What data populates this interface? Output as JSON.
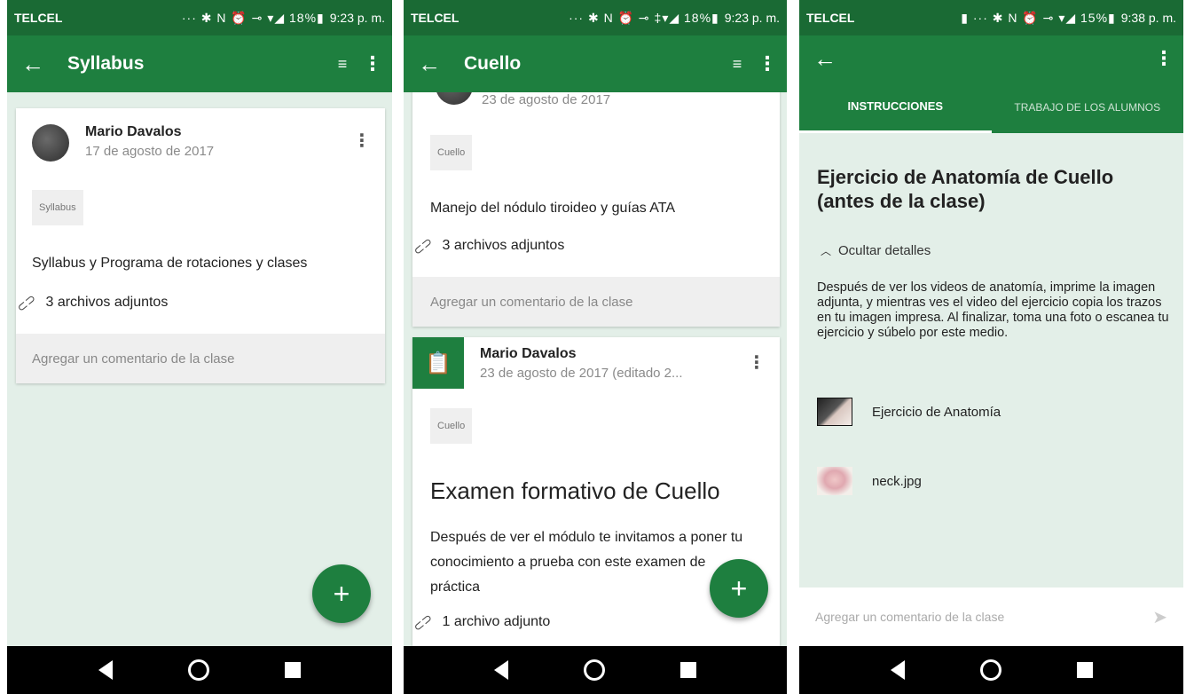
{
  "screens": [
    {
      "status": {
        "carrier": "TELCEL",
        "icons": "··· ✱ N ⏰ ⊸ ▾◢ 18%▮",
        "time": "9:23 p. m."
      },
      "appbar": {
        "title": "Syllabus"
      },
      "post": {
        "author": "Mario Davalos",
        "date": "17 de agosto de 2017",
        "topic": "Syllabus",
        "text": "Syllabus y Programa de rotaciones y clases",
        "attachments": "3 archivos adjuntos",
        "comment_placeholder": "Agregar un comentario de la clase"
      }
    },
    {
      "status": {
        "carrier": "TELCEL",
        "icons": "··· ✱ N ⏰ ⊸ ‡▾◢ 18%▮",
        "time": "9:23 p. m."
      },
      "appbar": {
        "title": "Cuello"
      },
      "post1": {
        "date": "23 de agosto de 2017",
        "topic": "Cuello",
        "text": "Manejo del nódulo tiroideo y guías ATA",
        "attachments": "3 archivos adjuntos",
        "comment_placeholder": "Agregar un comentario de la clase"
      },
      "post2": {
        "author": "Mario Davalos",
        "date": "23 de agosto de 2017 (editado 2...",
        "topic": "Cuello",
        "title": "Examen formativo de Cuello",
        "text": "Después de ver el módulo te invitamos a poner tu conocimiento a prueba con este examen de práctica",
        "attachments": "1 archivo adjunto"
      }
    },
    {
      "status": {
        "carrier": "TELCEL",
        "icons": "▮ ··· ✱ N ⏰ ⊸ ▾◢ 15%▮",
        "time": "9:38 p. m."
      },
      "tabs": {
        "instructions": "INSTRUCCIONES",
        "student_work": "TRABAJO DE LOS ALUMNOS"
      },
      "assignment": {
        "title": "Ejercicio de Anatomía de Cuello (antes de la clase)",
        "toggle_details": "Ocultar detalles",
        "description": "Después de ver los videos de anatomía, imprime la imagen adjunta, y mientras ves el video del ejercicio copia los trazos en tu imagen impresa. Al finalizar, toma una foto o escanea tu ejercicio y súbelo por este medio.",
        "attachments": [
          {
            "label": "Ejercicio de Anatomía",
            "icon": "video-thumbnail"
          },
          {
            "label": "neck.jpg",
            "icon": "image-thumbnail"
          }
        ],
        "comment_placeholder": "Agregar un comentario de la clase"
      }
    }
  ],
  "colors": {
    "primary": "#1e7f3f",
    "statusbar": "#1a6a34",
    "background": "#e3efe8"
  }
}
